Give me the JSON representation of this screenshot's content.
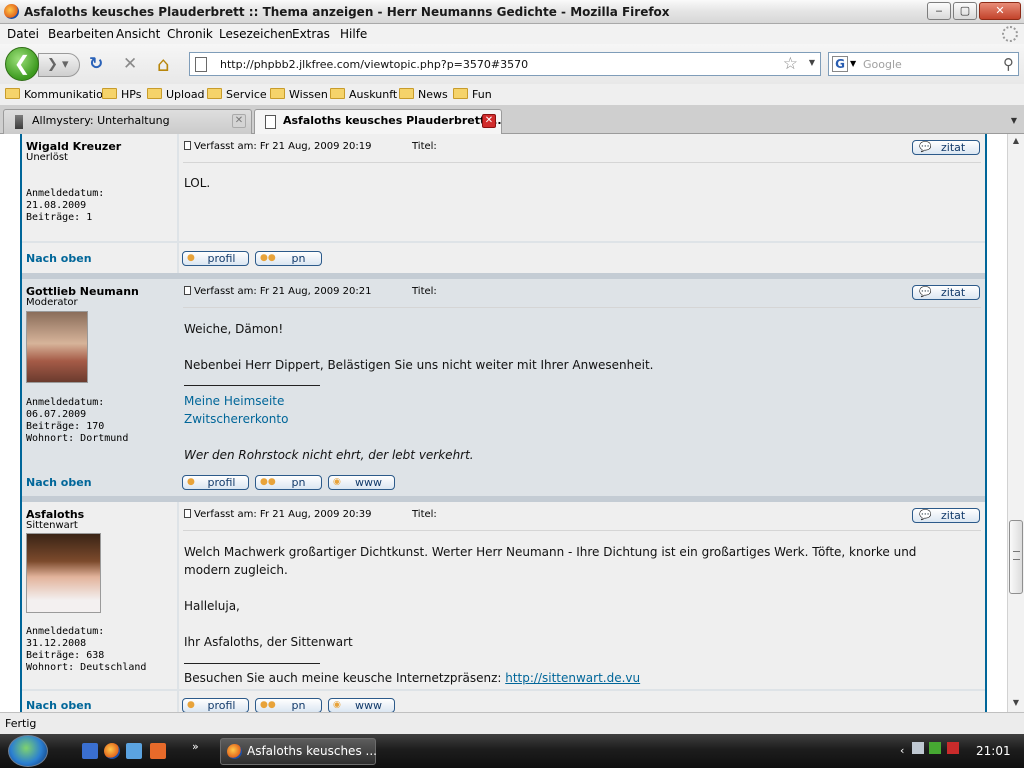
{
  "window": {
    "title": "Asfaloths keusches Plauderbrett :: Thema anzeigen - Herr Neumanns Gedichte - Mozilla Firefox",
    "controls": {
      "minimize": "‒",
      "maximize": "▢",
      "close": "✕"
    }
  },
  "menubar": [
    "Datei",
    "Bearbeiten",
    "Ansicht",
    "Chronik",
    "Lesezeichen",
    "Extras",
    "Hilfe"
  ],
  "navbar": {
    "back": "❮",
    "forward": "❯",
    "reload": "↻",
    "stop": "✕",
    "home": "⌂",
    "url": "http://phpbb2.jlkfree.com/viewtopic.php?p=3570#3570",
    "star": "☆",
    "search_engine": "G",
    "search_placeholder": "Google",
    "search_icon": "⚲"
  },
  "bookmarks": [
    "Kommunikation",
    "HPs",
    "Upload",
    "Service",
    "Wissen",
    "Auskunft",
    "News",
    "Fun"
  ],
  "tabs": [
    {
      "label": "Allmystery: Unterhaltung",
      "active": false
    },
    {
      "label": "Asfaloths keusches Plauderbrett ...",
      "active": true
    }
  ],
  "labels": {
    "zitat": "zitat",
    "profil": "profil",
    "pn": "pn",
    "www": "www",
    "nach_oben": "Nach oben",
    "titel": "Titel:"
  },
  "posts": [
    {
      "user": "Wigald Kreuzer",
      "rank": "Unerlöst",
      "joined_label": "Anmeldedatum:",
      "joined": "21.08.2009",
      "posts_label": "Beiträge: 1",
      "header": "Verfasst am: Fr 21 Aug, 2009 20:19",
      "text": [
        "LOL."
      ]
    },
    {
      "user": "Gottlieb Neumann",
      "rank": "Moderator",
      "joined_label": "Anmeldedatum:",
      "joined": "06.07.2009",
      "posts_label": "Beiträge: 170",
      "location": "Wohnort: Dortmund",
      "header": "Verfasst am: Fr 21 Aug, 2009 20:21",
      "text": [
        "Weiche, Dämon!",
        "Nebenbei Herr Dippert, Belästigen Sie uns nicht weiter mit Ihrer Anwesenheit."
      ],
      "sig_links": [
        "Meine Heimseite",
        "Zwitschererkonto"
      ],
      "sig_quote": "Wer den Rohrstock nicht ehrt, der lebt verkehrt."
    },
    {
      "user": "Asfaloths",
      "rank": "Sittenwart",
      "joined_label": "Anmeldedatum:",
      "joined": "31.12.2008",
      "posts_label": "Beiträge: 638",
      "location": "Wohnort: Deutschland",
      "header": "Verfasst am: Fr 21 Aug, 2009 20:39",
      "text": [
        "Welch Machwerk großartiger Dichtkunst. Werter Herr Neumann - Ihre Dichtung ist ein großartiges Werk. Töfte, knorke und",
        "modern zugleich.",
        "Halleluja,",
        "Ihr Asfaloths, der Sittenwart"
      ],
      "sig_text": "Besuchen Sie auch meine keusche Internetzpräsenz:",
      "sig_link": "http://sittenwart.de.vu"
    }
  ],
  "status": "Fertig",
  "taskbar": {
    "task": "Asfaloths keusches ...",
    "clock": "21:01"
  }
}
